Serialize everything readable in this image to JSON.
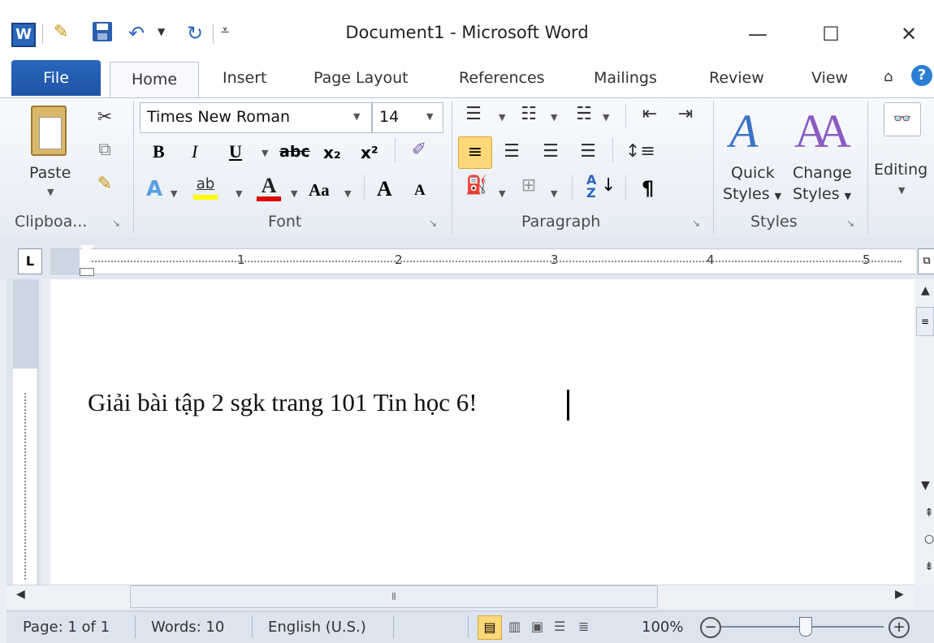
{
  "window": {
    "title": "Document1  -  Microsoft Word",
    "controls": {
      "minimize": "—",
      "maximize": "☐",
      "close": "✕"
    }
  },
  "qat": {
    "app_icon": "W",
    "icons": [
      "format-painter-icon",
      "save-icon",
      "undo-icon",
      "redo-icon",
      "customize-qat-icon"
    ]
  },
  "tabs": {
    "file": "File",
    "items": [
      "Home",
      "Insert",
      "Page Layout",
      "References",
      "Mailings",
      "Review",
      "View"
    ],
    "active": "Home"
  },
  "ribbon": {
    "clipboard": {
      "paste_label": "Paste",
      "group_label": "Clipboa..."
    },
    "font": {
      "font_name": "Times New Roman",
      "font_size": "14",
      "group_label": "Font",
      "bold": "B",
      "italic": "I",
      "underline": "U",
      "strike": "abc",
      "subscript": "x₂",
      "superscript": "x²",
      "change_case": "Aa",
      "grow": "A",
      "shrink": "A"
    },
    "paragraph": {
      "group_label": "Paragraph",
      "pilcrow": "¶"
    },
    "styles": {
      "quick_styles": "Quick",
      "quick_styles_2": "Styles",
      "change_styles": "Change",
      "change_styles_2": "Styles",
      "group_label": "Styles"
    },
    "editing": {
      "label": "Editing"
    }
  },
  "ruler": {
    "numbers": [
      "1",
      "2",
      "3",
      "4",
      "5"
    ]
  },
  "document": {
    "text": "Giải bài tập 2 sgk trang 101 Tin học 6!"
  },
  "status": {
    "page": "Page: 1 of 1",
    "words": "Words: 10",
    "language": "English (U.S.)",
    "zoom": "100%"
  },
  "colors": {
    "file_tab": "#1e54a6",
    "highlight": "#ffff00",
    "font_color": "#e00000",
    "accent": "#2a66bd"
  }
}
